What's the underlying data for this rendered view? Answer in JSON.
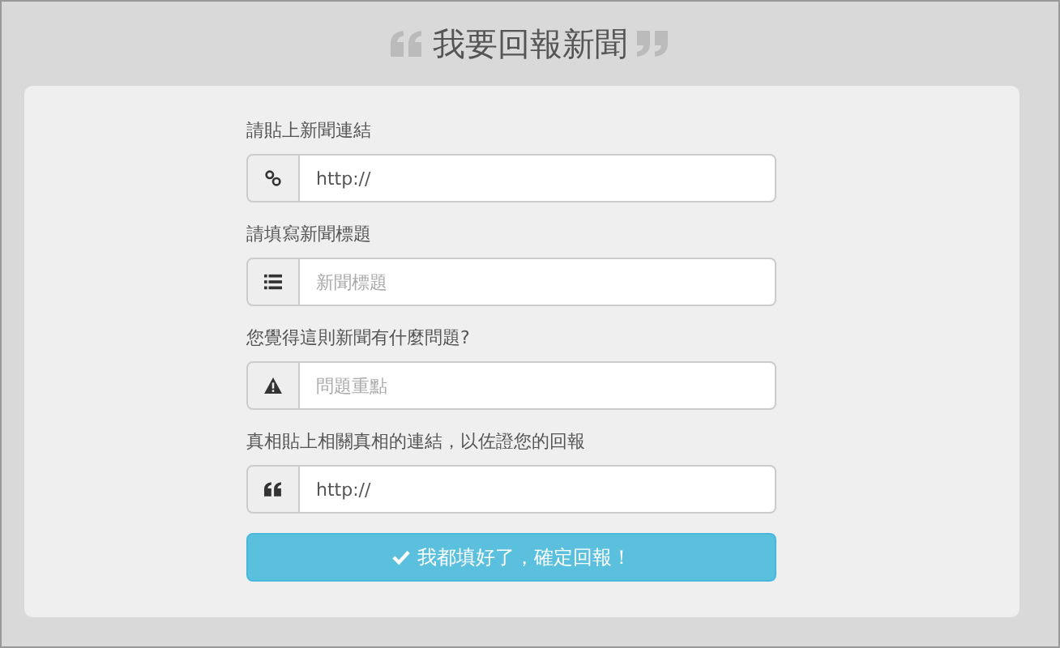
{
  "title": "我要回報新聞",
  "fields": [
    {
      "label": "請貼上新聞連結",
      "kind": "link",
      "value": "http://"
    },
    {
      "label": "請填寫新聞標題",
      "kind": "list",
      "placeholder": "新聞標題"
    },
    {
      "label": "您覺得這則新聞有什麼問題?",
      "kind": "warning",
      "placeholder": "問題重點"
    },
    {
      "label": "真相貼上相關真相的連結，以佐證您的回報",
      "kind": "quote",
      "value": "http://"
    }
  ],
  "submit": "我都填好了，確定回報！"
}
